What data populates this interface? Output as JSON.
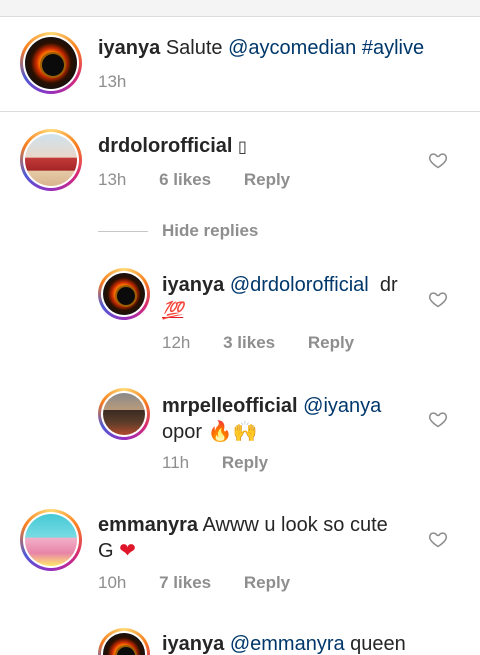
{
  "caption": {
    "username": "iyanya",
    "text": "Salute",
    "mention": "@aycomedian",
    "hashtag": "#aylive",
    "time": "13h"
  },
  "comments": [
    {
      "username": "drdolorofficial",
      "text": "",
      "emoji_glyph": "▯",
      "time": "13h",
      "likes": "6 likes",
      "reply": "Reply"
    }
  ],
  "hide_replies": "Hide replies",
  "replies": [
    {
      "username": "iyanya",
      "mention": "@drdolorofficial",
      "text": "dr",
      "emoji_glyph": "💯",
      "time": "12h",
      "likes": "3 likes",
      "reply": "Reply"
    },
    {
      "username": "mrpelleofficial",
      "mention": "@iyanya",
      "text": "opor",
      "emoji_glyph": "🔥🙌",
      "time": "11h",
      "reply": "Reply"
    }
  ],
  "comment2": {
    "username": "emmanyra",
    "text": "Awww u look so cute",
    "line2": "G",
    "emoji_glyph": "❤",
    "time": "10h",
    "likes": "7 likes",
    "reply": "Reply"
  },
  "partial": {
    "username": "iyanya",
    "mention": "@emmanyra",
    "text": "queen"
  },
  "colors": {
    "mention": "#00376b",
    "meta": "#8e8e8e",
    "divider": "#dbdbdb"
  },
  "icons": {
    "like": "heart-outline-icon"
  }
}
